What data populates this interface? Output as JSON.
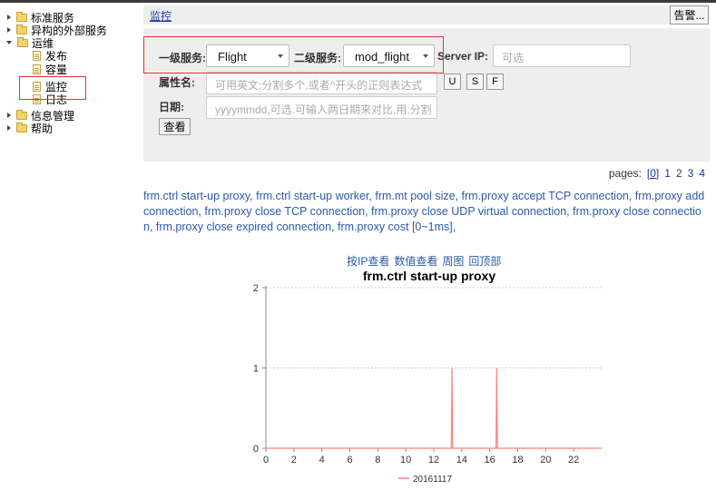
{
  "sidebar": {
    "items": [
      {
        "label": "标准服务",
        "type": "folder",
        "state": "collapsed"
      },
      {
        "label": "异构的外部服务",
        "type": "folder",
        "state": "collapsed"
      },
      {
        "label": "运维",
        "type": "folder",
        "state": "expanded"
      },
      {
        "label": "发布",
        "type": "doc"
      },
      {
        "label": "容量",
        "type": "doc"
      },
      {
        "label": "监控",
        "type": "doc",
        "selected": true
      },
      {
        "label": "日志",
        "type": "doc"
      },
      {
        "label": "信息管理",
        "type": "folder",
        "state": "collapsed"
      },
      {
        "label": "帮助",
        "type": "folder",
        "state": "collapsed"
      }
    ]
  },
  "header": {
    "breadcrumb": "监控",
    "alarm_button": "告警..."
  },
  "filters": {
    "level1_label": "一级服务:",
    "level1_value": "Flight",
    "level2_label": "二级服务:",
    "level2_value": "mod_flight",
    "server_ip_label": "Server IP:",
    "server_ip_placeholder": "可选",
    "attr_label": "属性名:",
    "attr_placeholder": "可用英文;分割多个,或者^开头的正则表达式",
    "btn_u": "U",
    "btn_s": "S",
    "btn_f": "F",
    "date_label": "日期:",
    "date_placeholder": "yyyymmdd,可选.可输入两日期来对比,用;分割",
    "view_button": "查看"
  },
  "pagination": {
    "label": "pages:",
    "pages": [
      "[0]",
      "1",
      "2",
      "3",
      "4"
    ]
  },
  "metrics_text": "frm.ctrl start-up proxy, frm.ctrl start-up worker, frm.mt pool size, frm.proxy accept TCP connection, frm.proxy add connection, frm.proxy close TCP connection, frm.proxy close UDP virtual connection, frm.proxy close connection, frm.proxy close expired connection, frm.proxy cost [0~1ms],",
  "chart_links": [
    "按IP查看",
    "数值查看",
    "周图",
    "回顶部"
  ],
  "colors": {
    "accent_red": "#e03535",
    "link_blue": "#2a5aa8",
    "series_line": "#ff8080"
  },
  "chart_data": {
    "type": "line",
    "title": "frm.ctrl start-up proxy",
    "xlabel": "",
    "ylabel": "",
    "xlim": [
      0,
      24
    ],
    "ylim": [
      0,
      2
    ],
    "x_ticks": [
      0,
      2,
      4,
      6,
      8,
      10,
      12,
      14,
      16,
      18,
      20,
      22
    ],
    "y_ticks": [
      0,
      1,
      2
    ],
    "grid": "horizontal-dashed",
    "legend": "bottom-center",
    "series": [
      {
        "name": "20161117",
        "color": "#ff8080",
        "points": [
          [
            0,
            0
          ],
          [
            13.25,
            0
          ],
          [
            13.3,
            1
          ],
          [
            13.35,
            0
          ],
          [
            16.45,
            0
          ],
          [
            16.5,
            1
          ],
          [
            16.55,
            0
          ],
          [
            24,
            0
          ]
        ]
      }
    ]
  }
}
